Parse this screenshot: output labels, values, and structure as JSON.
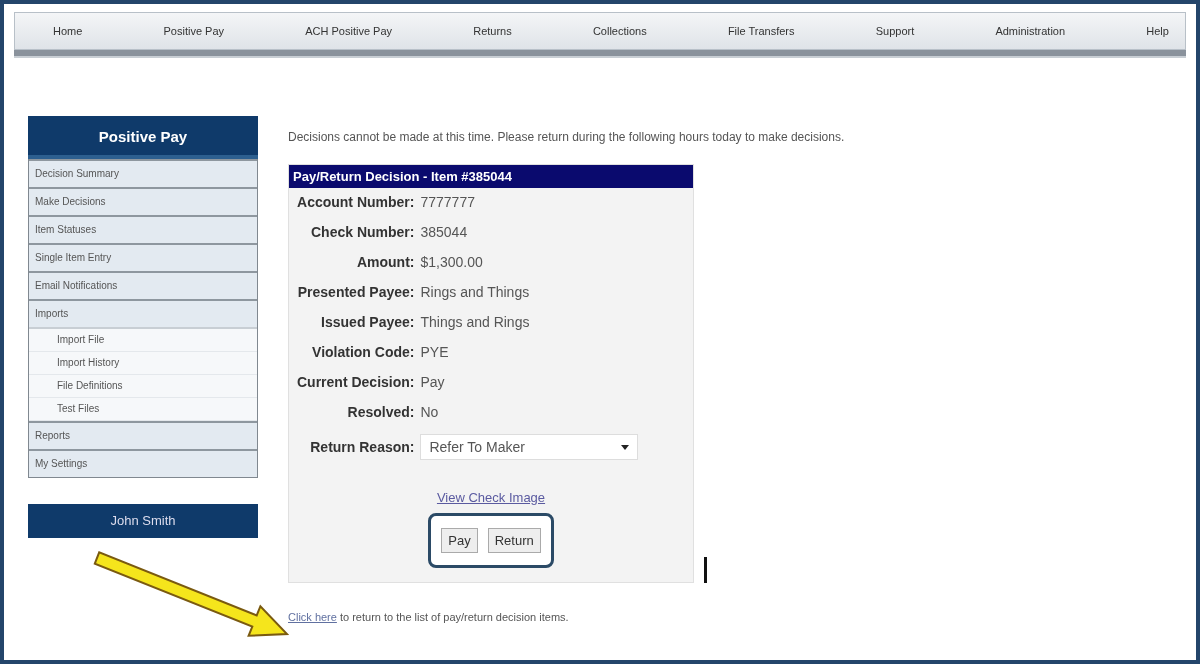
{
  "nav": [
    "Home",
    "Positive Pay",
    "ACH Positive Pay",
    "Returns",
    "Collections",
    "File Transfers",
    "Support",
    "Administration",
    "Help"
  ],
  "sidebar": {
    "title": "Positive Pay",
    "items": [
      {
        "label": "Decision Summary"
      },
      {
        "label": "Make Decisions"
      },
      {
        "label": "Item Statuses"
      },
      {
        "label": "Single Item Entry"
      },
      {
        "label": "Email Notifications"
      },
      {
        "label": "Imports",
        "children": [
          {
            "label": "Import File"
          },
          {
            "label": "Import History"
          },
          {
            "label": "File Definitions"
          },
          {
            "label": "Test Files"
          }
        ]
      },
      {
        "label": "Reports"
      },
      {
        "label": "My Settings"
      }
    ],
    "user": "John Smith"
  },
  "message": "Decisions cannot be made at this time. Please return during the following hours today to make decisions.",
  "decision": {
    "title": "Pay/Return Decision - Item #385044",
    "fields": [
      {
        "label": "Account Number:",
        "value": "7777777"
      },
      {
        "label": "Check Number:",
        "value": "385044"
      },
      {
        "label": "Amount:",
        "value": "$1,300.00"
      },
      {
        "label": "Presented Payee:",
        "value": "Rings and Things"
      },
      {
        "label": "Issued Payee:",
        "value": "Things and Rings"
      },
      {
        "label": "Violation Code:",
        "value": "PYE"
      },
      {
        "label": "Current Decision:",
        "value": "Pay"
      },
      {
        "label": "Resolved:",
        "value": "No"
      }
    ],
    "return_reason": {
      "label": "Return Reason:",
      "value": "Refer To Maker"
    },
    "link": "View Check Image",
    "buttons": [
      "Pay",
      "Return"
    ]
  },
  "footer": {
    "link": "Click here",
    "text": " to return to the list of pay/return decision items."
  }
}
